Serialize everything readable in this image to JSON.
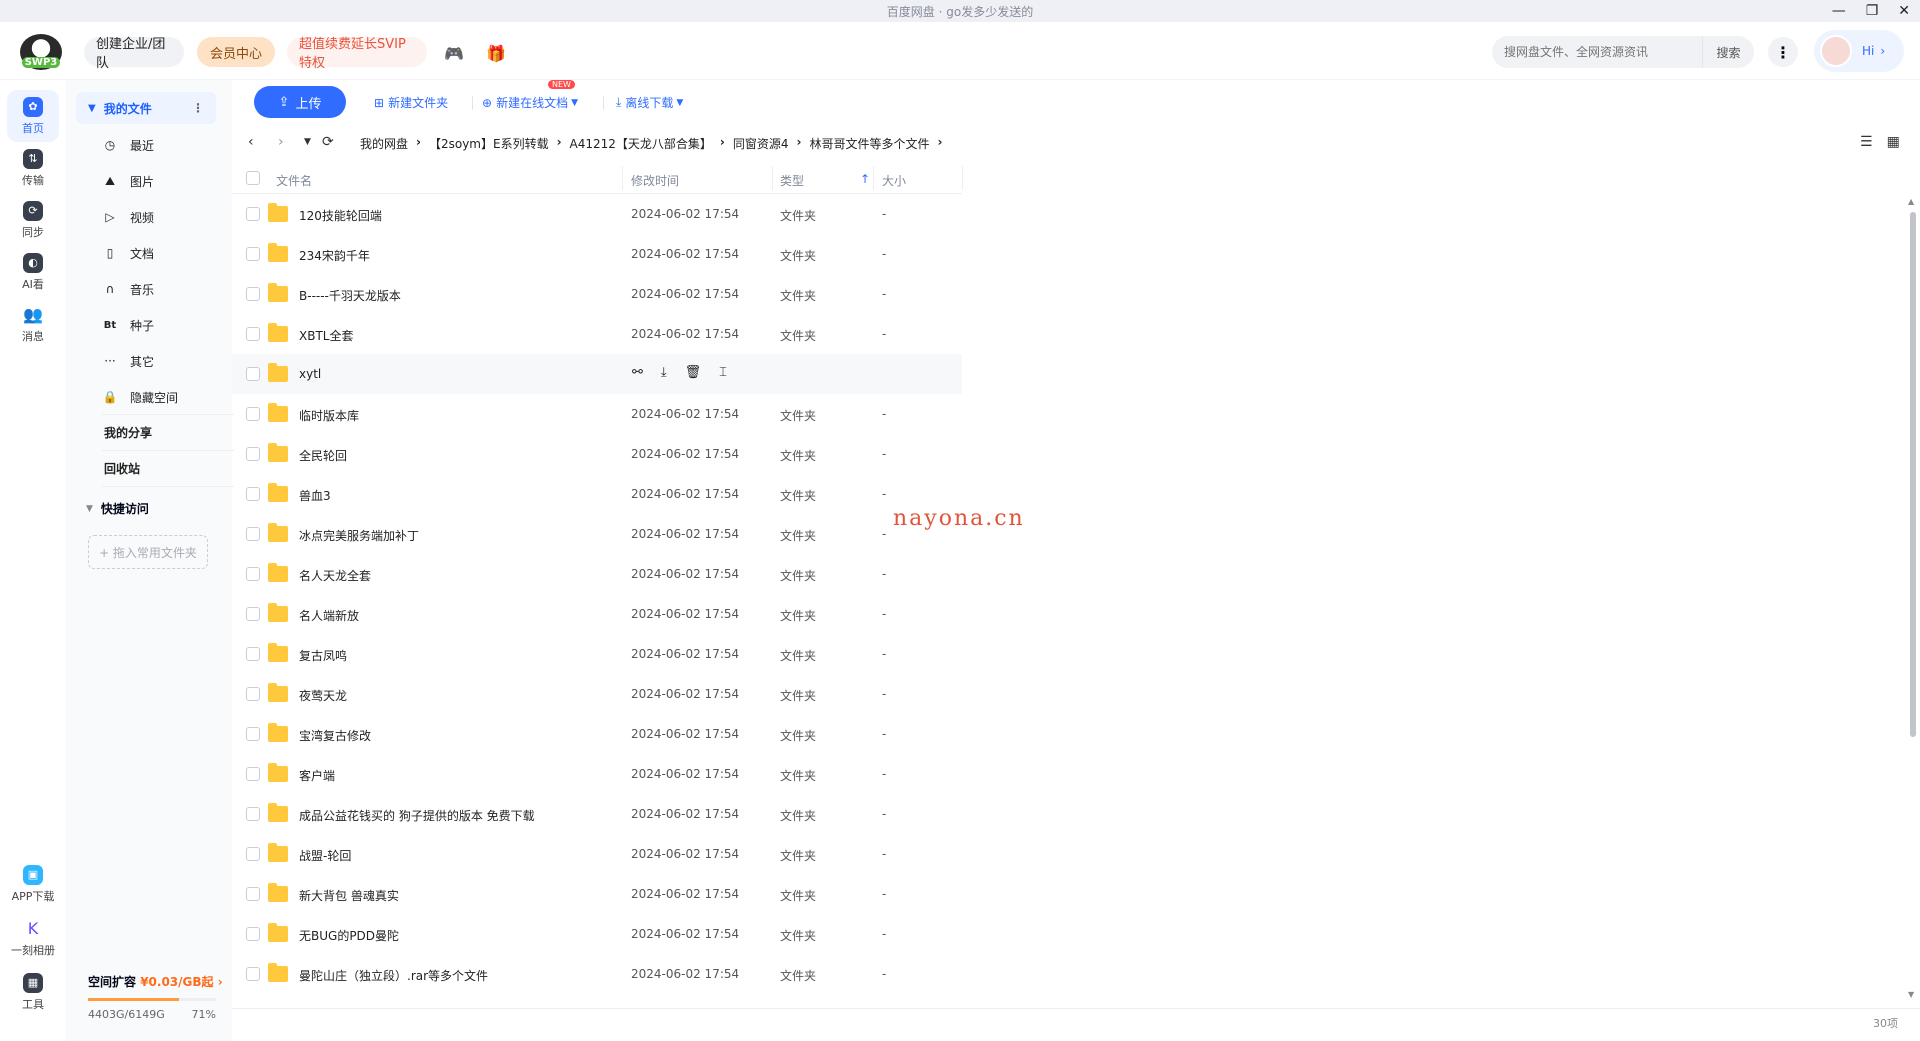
{
  "window": {
    "title": "百度网盘 · go发多少发送的"
  },
  "topbar": {
    "logo_text": "SWP3",
    "team_btn": "创建企业/团队",
    "vip_btn": "会员中心",
    "svip_btn": "超值续费延长SVIP特权",
    "search_placeholder": "搜网盘文件、全网资源资讯",
    "search_btn": "搜索",
    "hi": "Hi"
  },
  "rail": [
    {
      "label": "首页",
      "icon": "home-icon"
    },
    {
      "label": "传输",
      "icon": "transfer-icon"
    },
    {
      "label": "同步",
      "icon": "sync-icon"
    },
    {
      "label": "AI看",
      "icon": "ai-icon"
    },
    {
      "label": "消息",
      "icon": "message-icon"
    },
    {
      "label": "APP下载",
      "icon": "app-download-icon"
    },
    {
      "label": "一刻相册",
      "icon": "album-icon"
    },
    {
      "label": "工具",
      "icon": "tools-icon"
    }
  ],
  "sidebar": {
    "my_files": "我的文件",
    "items": [
      {
        "label": "最近",
        "glyph": "◷"
      },
      {
        "label": "图片",
        "glyph": "⛰"
      },
      {
        "label": "视频",
        "glyph": "▷"
      },
      {
        "label": "文档",
        "glyph": "▯"
      },
      {
        "label": "音乐",
        "glyph": "∩"
      },
      {
        "label": "种子",
        "glyph": "Bt"
      },
      {
        "label": "其它",
        "glyph": "···"
      },
      {
        "label": "隐藏空间",
        "glyph": "🔒"
      }
    ],
    "my_share": "我的分享",
    "recycle": "回收站",
    "quick_access": "快捷访问",
    "drag_hint": "+ 拖入常用文件夹",
    "expand_label": "空间扩容",
    "expand_price": "¥0.03/GB起",
    "usage": "4403G/6149G",
    "usage_pct": "71%",
    "usage_fraction": 0.71
  },
  "toolbar": {
    "upload": "上传",
    "new_folder": "新建文件夹",
    "new_doc": "新建在线文档",
    "new_badge": "NEW",
    "offline": "离线下载"
  },
  "breadcrumb": [
    "我的网盘",
    "【2soym】E系列转载",
    "A41212【天龙八部合集】",
    "同窗资源4",
    "林哥哥文件等多个文件"
  ],
  "table": {
    "headers": {
      "name": "文件名",
      "modified": "修改时间",
      "type": "类型",
      "size": "大小"
    },
    "rows": [
      {
        "name": "120技能轮回端",
        "date": "2024-06-02 17:54",
        "type": "文件夹",
        "size": "-"
      },
      {
        "name": "234宋韵千年",
        "date": "2024-06-02 17:54",
        "type": "文件夹",
        "size": "-"
      },
      {
        "name": "B-----千羽天龙版本",
        "date": "2024-06-02 17:54",
        "type": "文件夹",
        "size": "-"
      },
      {
        "name": "XBTL全套",
        "date": "2024-06-02 17:54",
        "type": "文件夹",
        "size": "-"
      },
      {
        "name": "xytl",
        "date": "",
        "type": "",
        "size": ""
      },
      {
        "name": "临时版本库",
        "date": "2024-06-02 17:54",
        "type": "文件夹",
        "size": "-"
      },
      {
        "name": "全民轮回",
        "date": "2024-06-02 17:54",
        "type": "文件夹",
        "size": "-"
      },
      {
        "name": "兽血3",
        "date": "2024-06-02 17:54",
        "type": "文件夹",
        "size": "-"
      },
      {
        "name": "冰点完美服务端加补丁",
        "date": "2024-06-02 17:54",
        "type": "文件夹",
        "size": "-"
      },
      {
        "name": "名人天龙全套",
        "date": "2024-06-02 17:54",
        "type": "文件夹",
        "size": "-"
      },
      {
        "name": "名人端新放",
        "date": "2024-06-02 17:54",
        "type": "文件夹",
        "size": "-"
      },
      {
        "name": "复古凤鸣",
        "date": "2024-06-02 17:54",
        "type": "文件夹",
        "size": "-"
      },
      {
        "name": "夜莺天龙",
        "date": "2024-06-02 17:54",
        "type": "文件夹",
        "size": "-"
      },
      {
        "name": "宝湾复古修改",
        "date": "2024-06-02 17:54",
        "type": "文件夹",
        "size": "-"
      },
      {
        "name": "客户端",
        "date": "2024-06-02 17:54",
        "type": "文件夹",
        "size": "-"
      },
      {
        "name": "成品公益花钱买的 狗子提供的版本 免费下载",
        "date": "2024-06-02 17:54",
        "type": "文件夹",
        "size": "-"
      },
      {
        "name": "战盟-轮回",
        "date": "2024-06-02 17:54",
        "type": "文件夹",
        "size": "-"
      },
      {
        "name": "新大背包 兽魂真实",
        "date": "2024-06-02 17:54",
        "type": "文件夹",
        "size": "-"
      },
      {
        "name": "无BUG的PDD曼陀",
        "date": "2024-06-02 17:54",
        "type": "文件夹",
        "size": "-"
      },
      {
        "name": "曼陀山庄（独立段）.rar等多个文件",
        "date": "2024-06-02 17:54",
        "type": "文件夹",
        "size": "-"
      }
    ],
    "hover_actions": [
      "share-icon",
      "download-icon",
      "delete-icon",
      "rename-icon"
    ]
  },
  "watermark": "nayona.cn",
  "item_count": "30项"
}
